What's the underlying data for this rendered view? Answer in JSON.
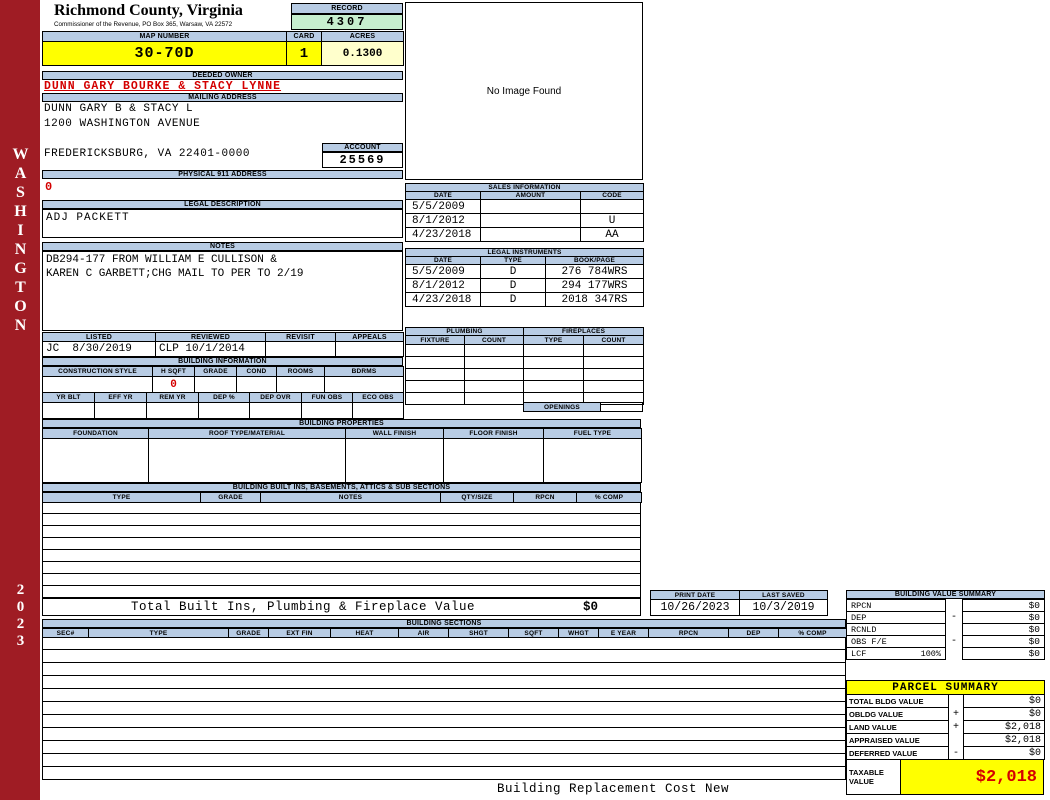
{
  "colors": {
    "sidebar_maroon": "#9F1C24",
    "header_blue": "#B8CCE4",
    "highlight_yellow": "#FFFF00",
    "acres_cream": "#FFFFCC",
    "record_green": "#C6EFCE",
    "alert_red": "#D40000"
  },
  "sidebar": {
    "vertical_text": "WASHINGTON",
    "year": "2023"
  },
  "header": {
    "county_title": "Richmond County, Virginia",
    "county_subtitle": "Commissioner of the Revenue, PO Box 365, Warsaw, VA 22572",
    "record_label": "RECORD",
    "record_value": "4307",
    "map_number_label": "MAP NUMBER",
    "map_number_value": "30-70D",
    "card_label": "CARD",
    "card_value": "1",
    "acres_label": "ACRES",
    "acres_value": "0.1300"
  },
  "owner": {
    "deeded_owner_label": "DEEDED OWNER",
    "deeded_owner_value": "DUNN GARY BOURKE & STACY LYNNE",
    "mailing_address_label": "MAILING ADDRESS",
    "mailing_lines": [
      "DUNN GARY B & STACY L",
      "1200 WASHINGTON AVENUE",
      "",
      "FREDERICKSBURG, VA 22401-0000"
    ],
    "account_label": "ACCOUNT",
    "account_value": "25569",
    "physical_address_label": "PHYSICAL 911 ADDRESS",
    "physical_address_value": "0",
    "legal_description_label": "LEGAL DESCRIPTION",
    "legal_description_value": "ADJ PACKETT",
    "notes_label": "NOTES",
    "notes_lines": [
      "DB294-177 FROM WILLIAM E CULLISON &",
      "KAREN C GARBETT;CHG MAIL TO PER TO 2/19"
    ]
  },
  "image_panel": {
    "message": "No Image Found"
  },
  "sales": {
    "title": "SALES INFORMATION",
    "headers": [
      "DATE",
      "AMOUNT",
      "CODE"
    ],
    "rows": [
      {
        "date": "5/5/2009",
        "amount": "",
        "code": ""
      },
      {
        "date": "8/1/2012",
        "amount": "",
        "code": "U"
      },
      {
        "date": "4/23/2018",
        "amount": "",
        "code": "AA"
      }
    ]
  },
  "legal_instruments": {
    "title": "LEGAL INSTRUMENTS",
    "headers": [
      "DATE",
      "TYPE",
      "BOOK/PAGE"
    ],
    "rows": [
      {
        "date": "5/5/2009",
        "type": "D",
        "book_page": "276 784WRS"
      },
      {
        "date": "8/1/2012",
        "type": "D",
        "book_page": "294 177WRS"
      },
      {
        "date": "4/23/2018",
        "type": "D",
        "book_page": "2018 347RS"
      }
    ]
  },
  "plumbing": {
    "title": "PLUMBING",
    "fixture_header": "FIXTURE",
    "count_header": "COUNT"
  },
  "fireplaces": {
    "title": "FIREPLACES",
    "type_header": "TYPE",
    "count_header": "COUNT",
    "openings_label": "OPENINGS"
  },
  "review": {
    "listed_label": "LISTED",
    "listed_value": "JC  8/30/2019",
    "reviewed_label": "REVIEWED",
    "reviewed_value": "CLP 10/1/2014",
    "revisit_label": "REVISIT",
    "revisit_value": "",
    "appeals_label": "APPEALS",
    "appeals_value": ""
  },
  "building_info": {
    "title": "BUILDING INFORMATION",
    "row1_headers": [
      "CONSTRUCTION STYLE",
      "H SQFT",
      "GRADE",
      "COND",
      "ROOMS",
      "BDRMS"
    ],
    "row1_values": [
      "",
      "0",
      "",
      "",
      "",
      ""
    ],
    "row2_headers": [
      "YR BLT",
      "EFF YR",
      "REM YR",
      "DEP %",
      "DEP OVR",
      "FUN OBS",
      "ECO OBS"
    ],
    "row2_values": [
      "",
      "",
      "",
      "",
      "",
      "",
      ""
    ]
  },
  "building_properties": {
    "title": "BUILDING PROPERTIES",
    "headers": [
      "FOUNDATION",
      "ROOF TYPE/MATERIAL",
      "WALL FINISH",
      "FLOOR FINISH",
      "FUEL TYPE"
    ]
  },
  "built_ins": {
    "title": "BUILDING BUILT INS, BASEMENTS, ATTICS & SUB SECTIONS",
    "headers": [
      "TYPE",
      "GRADE",
      "NOTES",
      "QTY/SIZE",
      "RPCN",
      "% COMP"
    ],
    "total_label": "Total Built Ins, Plumbing & Fireplace Value",
    "total_value": "$0"
  },
  "print_info": {
    "print_date_label": "PRINT DATE",
    "print_date_value": "10/26/2023",
    "last_saved_label": "LAST SAVED",
    "last_saved_value": "10/3/2019"
  },
  "building_value_summary": {
    "title": "BUILDING VALUE SUMMARY",
    "rows": [
      {
        "label": "RPCN",
        "pct": "",
        "op": "",
        "value": "$0"
      },
      {
        "label": "DEP",
        "pct": "",
        "op": "-",
        "value": "$0"
      },
      {
        "label": "RCNLD",
        "pct": "",
        "op": "",
        "value": "$0"
      },
      {
        "label": "OBS F/E",
        "pct": "",
        "op": "-",
        "value": "$0"
      },
      {
        "label": "LCF",
        "pct": "100%",
        "op": "",
        "value": "$0"
      }
    ]
  },
  "building_sections": {
    "title": "BUILDING SECTIONS",
    "headers": [
      "SEC#",
      "TYPE",
      "GRADE",
      "EXT FIN",
      "HEAT",
      "AIR",
      "SHGT",
      "SQFT",
      "WHGT",
      "E YEAR",
      "RPCN",
      "DEP",
      "% COMP"
    ]
  },
  "parcel_summary": {
    "title": "PARCEL SUMMARY",
    "rows": [
      {
        "label": "TOTAL BLDG VALUE",
        "op": "",
        "value": "$0"
      },
      {
        "label": "OBLDG VALUE",
        "op": "+",
        "value": "$0"
      },
      {
        "label": "LAND VALUE",
        "op": "+",
        "value": "$2,018"
      },
      {
        "label": "APPRAISED VALUE",
        "op": "",
        "value": "$2,018"
      },
      {
        "label": "DEFERRED VALUE",
        "op": "-",
        "value": "$0"
      }
    ],
    "taxable_label": "TAXABLE VALUE",
    "taxable_value": "$2,018"
  },
  "footer": {
    "text": "Building Replacement Cost New"
  }
}
